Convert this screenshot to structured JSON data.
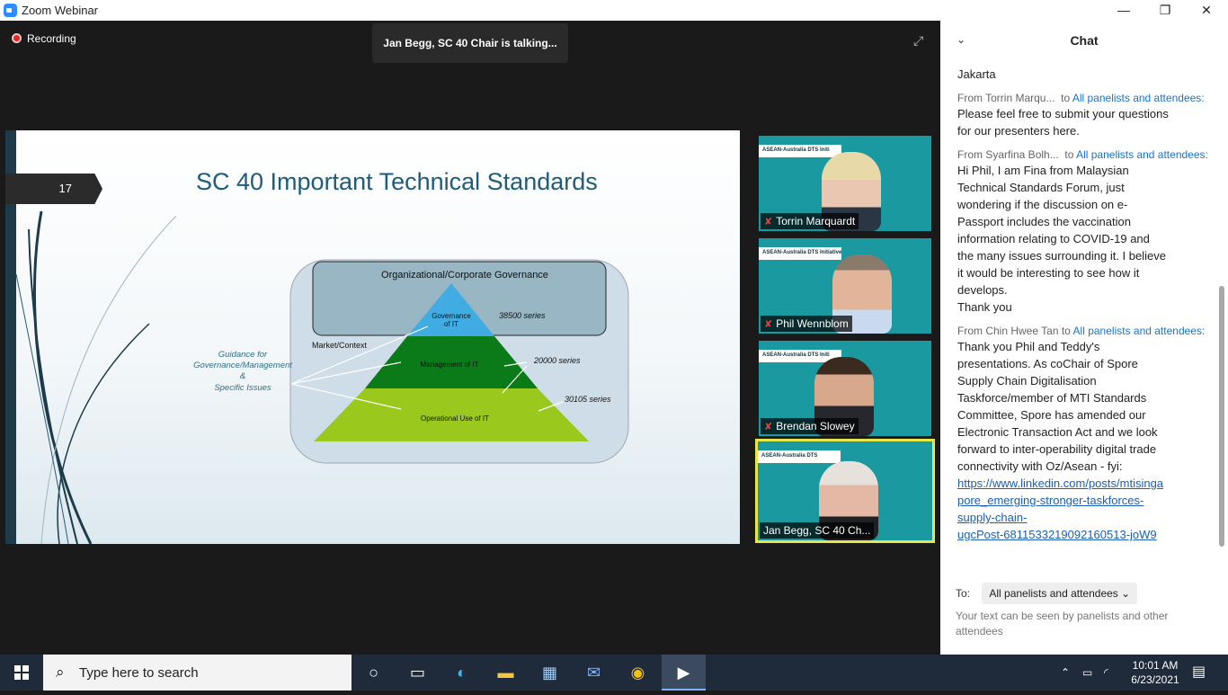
{
  "window": {
    "title": "Zoom Webinar",
    "minimize": "—",
    "restore": "❐",
    "close": "✕"
  },
  "meeting": {
    "recording_label": "Recording",
    "talking_banner": "Jan Begg, SC 40 Chair is talking...",
    "expand_icon": "⤢"
  },
  "slide": {
    "number": "17",
    "title": "SC 40 Important Technical Standards",
    "org_gov": "Organizational/Corporate Governance",
    "gov_it": [
      "Governance",
      "of IT"
    ],
    "series_38500": "38500 series",
    "series_20000": "20000 series",
    "series_30105": "30105 series",
    "market": "Market/Context",
    "mgmt_it": "Management of IT",
    "op_it": "Operational Use of IT",
    "guidance": [
      "Guidance for",
      "Governance/Management",
      "&",
      "Specific Issues"
    ]
  },
  "participants": [
    {
      "name": "Torrin Marquardt",
      "muted": true,
      "strip": "ASEAN-Australia DTS Initi"
    },
    {
      "name": "Phil Wennblom",
      "muted": true,
      "strip": "ASEAN-Australia DTS Initiative"
    },
    {
      "name": "Brendan Slowey",
      "muted": true,
      "strip": "ASEAN-Australia DTS Initi"
    },
    {
      "name": "Jan Begg, SC 40 Ch...",
      "muted": false,
      "strip": "ASEAN-Australia DTS"
    }
  ],
  "mic_icon": "✘",
  "chat": {
    "title": "Chat",
    "collapse_icon": "⌄",
    "top_fragment": "Jakarta",
    "messages": [
      {
        "from": "From Torrin Marqu...",
        "to_prefix": "to",
        "to": "All panelists and attendees:",
        "lines": [
          "Please feel free to submit your questions",
          "for our presenters here."
        ]
      },
      {
        "from": "From Syarfina Bolh...",
        "to_prefix": "to",
        "to": "All panelists and attendees:",
        "lines": [
          "Hi Phil, I am Fina from Malaysian",
          "Technical Standards Forum, just",
          "wondering if the discussion on e-",
          "Passport includes the vaccination",
          "information relating to COVID-19 and",
          "the many issues surrounding it. I believe",
          "it would be interesting to see how it",
          "develops.",
          "Thank you"
        ]
      },
      {
        "from": "From Chin Hwee Tan",
        "to_prefix": "to",
        "to": "All panelists and attendees:",
        "lines": [
          "Thank you Phil and Teddy's",
          "presentations. As coChair of Spore",
          "Supply Chain Digitalisation",
          "Taskforce/member of MTI Standards",
          "Committee, Spore has amended our",
          "Electronic Transaction Act and we look",
          "forward to inter-operability digital trade",
          "connectivity with Oz/Asean - fyi:"
        ],
        "link": [
          "https://www.linkedin.com/posts/mtisinga",
          "pore_emerging-stronger-taskforces-",
          "supply-chain-",
          "ugcPost-6811533219092160513-joW9"
        ]
      }
    ],
    "to_label": "To:",
    "to_value": "All panelists and attendees",
    "dropdown_icon": "⌄",
    "hint": "Your text can be seen by panelists and other attendees"
  },
  "taskbar": {
    "search_placeholder": "Type here to search",
    "search_icon": "⌕",
    "time": "10:01 AM",
    "date": "6/23/2021",
    "apps": [
      "cortana-icon",
      "task-view-icon",
      "edge-icon",
      "file-explorer-icon",
      "store-icon",
      "mail-icon",
      "chrome-icon",
      "zoom-icon"
    ]
  },
  "colors": {
    "accent": "#2d8cff",
    "slide_title": "#1f5c78",
    "dark_green": "#0b7a18",
    "mid_green": "#1aa326",
    "light_green": "#9ac81d",
    "gov_blue": "#41ace1"
  }
}
